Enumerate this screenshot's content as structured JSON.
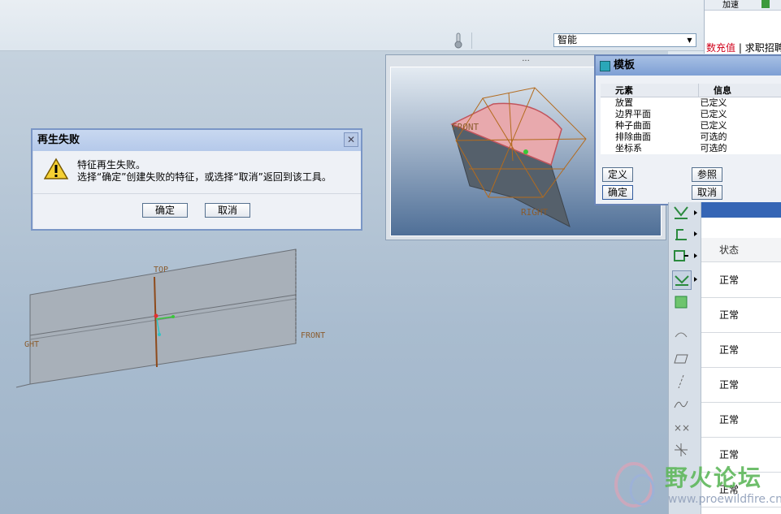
{
  "toolbar": {
    "filter_value": "智能"
  },
  "error_dialog": {
    "title": "再生失败",
    "message_line1": "特征再生失败。",
    "message_line2": "选择“确定”创建失败的特征，或选择“取消”返回到该工具。",
    "ok_label": "确定",
    "cancel_label": "取消"
  },
  "preview": {
    "grip": "...",
    "datum_front": "FRONT",
    "datum_right": "RIGHT"
  },
  "main_view": {
    "datum_top": "TOP",
    "datum_front": "FRONT",
    "datum_right": "GHT"
  },
  "template_dialog": {
    "title": "模板",
    "columns": [
      "元素",
      "信息"
    ],
    "rows": [
      {
        "element": "放置",
        "info": "已定义"
      },
      {
        "element": "边界平面",
        "info": "已定义"
      },
      {
        "element": "种子曲面",
        "info": "已定义"
      },
      {
        "element": "排除曲面",
        "info": "可选的"
      },
      {
        "element": "坐标系",
        "info": "可选的"
      }
    ],
    "buttons": {
      "define": "定义",
      "reference": "参照",
      "ok": "确定",
      "cancel": "取消"
    }
  },
  "browser_strip": {
    "top_button": "加速",
    "link_red": "数充值",
    "link_sep": " | ",
    "link_text": "求职招聘"
  },
  "status_panel": {
    "header": "状态",
    "rows": [
      "正常",
      "正常",
      "正常",
      "正常",
      "正常",
      "正常",
      "正常"
    ]
  },
  "watermark": {
    "name": "野火论坛",
    "url": "www.proewildfire.cn"
  },
  "colors": {
    "dialog_title_bg": "#b5c9ea",
    "surface_pink": "#e8a9ad",
    "datum_orange": "#b36b1e",
    "panel_blue": "#3565b5"
  }
}
